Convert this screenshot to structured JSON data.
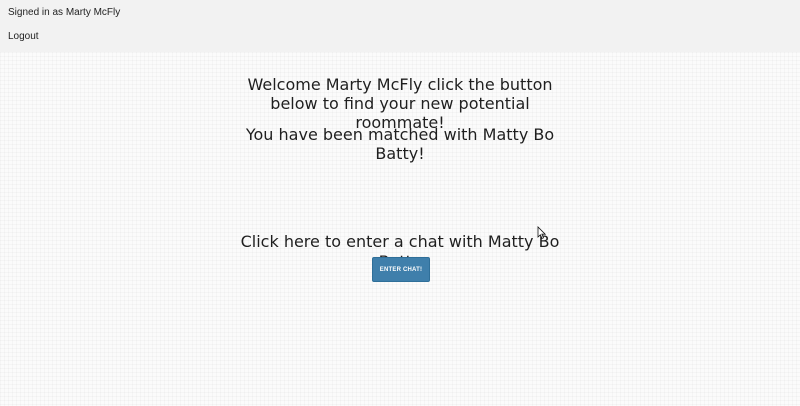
{
  "header": {
    "signed_in_text": "Signed in as Marty McFly",
    "logout_label": "Logout"
  },
  "main": {
    "welcome_text": "Welcome Marty McFly click the button below to find your new potential roommate!",
    "match_text": "You have been matched with Matty Bo Batty!",
    "chat_prompt": "Click here to enter a chat with Matty Bo Batty",
    "enter_chat_label": "Enter Chat!"
  },
  "colors": {
    "button_bg": "#3f7fab",
    "page_bg": "#fbfbfb"
  },
  "icons": {
    "cursor": "mouse-pointer-icon"
  }
}
